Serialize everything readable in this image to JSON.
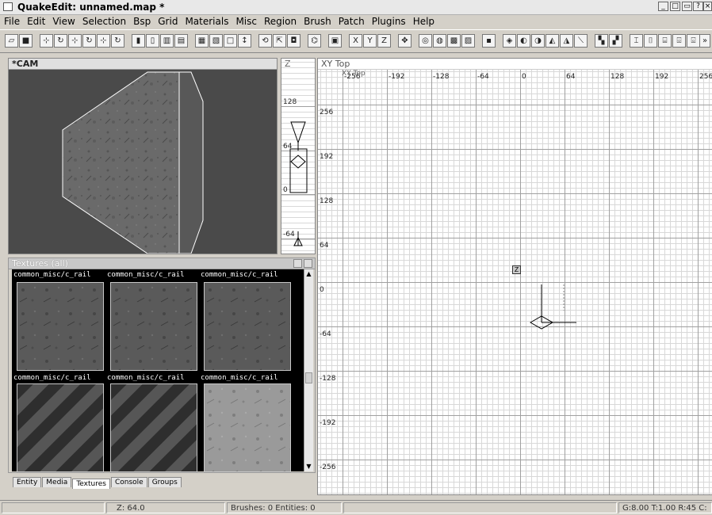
{
  "window": {
    "title": "QuakeEdit: unnamed.map *"
  },
  "menubar": [
    "File",
    "Edit",
    "View",
    "Selection",
    "Bsp",
    "Grid",
    "Materials",
    "Misc",
    "Region",
    "Brush",
    "Patch",
    "Plugins",
    "Help"
  ],
  "camera": {
    "label": "*CAM"
  },
  "zview": {
    "label": "Z",
    "ticks": [
      "128",
      "64",
      "0",
      "-64"
    ]
  },
  "xyview": {
    "label": "XY Top",
    "overlay_label": "XY Top",
    "x_ticks": [
      "-256",
      "-192",
      "-128",
      "-64",
      "0",
      "64",
      "128",
      "192",
      "256"
    ],
    "y_ticks": [
      "256",
      "192",
      "128",
      "64",
      "0",
      "-64",
      "-128",
      "-192",
      "-256"
    ],
    "z_marker": "Z"
  },
  "textures": {
    "label": "Textures (all)",
    "labels_row1": [
      "common_misc/c_rail",
      "common_misc/c_rail",
      "common_misc/c_rail"
    ],
    "labels_row2": [
      "common_misc/c_rail",
      "common_misc/c_rail",
      "common_misc/c_rail"
    ]
  },
  "tabs": [
    "Entity",
    "Media",
    "Textures",
    "Console",
    "Groups"
  ],
  "active_tab": "Textures",
  "status": {
    "z": "Z: 64.0",
    "counts": "Brushes: 0 Entities: 0",
    "grid": "G:8.00 T:1.00 R:45 C:"
  },
  "colors": {
    "cam_bg": "#4a4a4a",
    "grid_minor": "#d8d8d8",
    "grid_major": "#a0a0a0"
  }
}
